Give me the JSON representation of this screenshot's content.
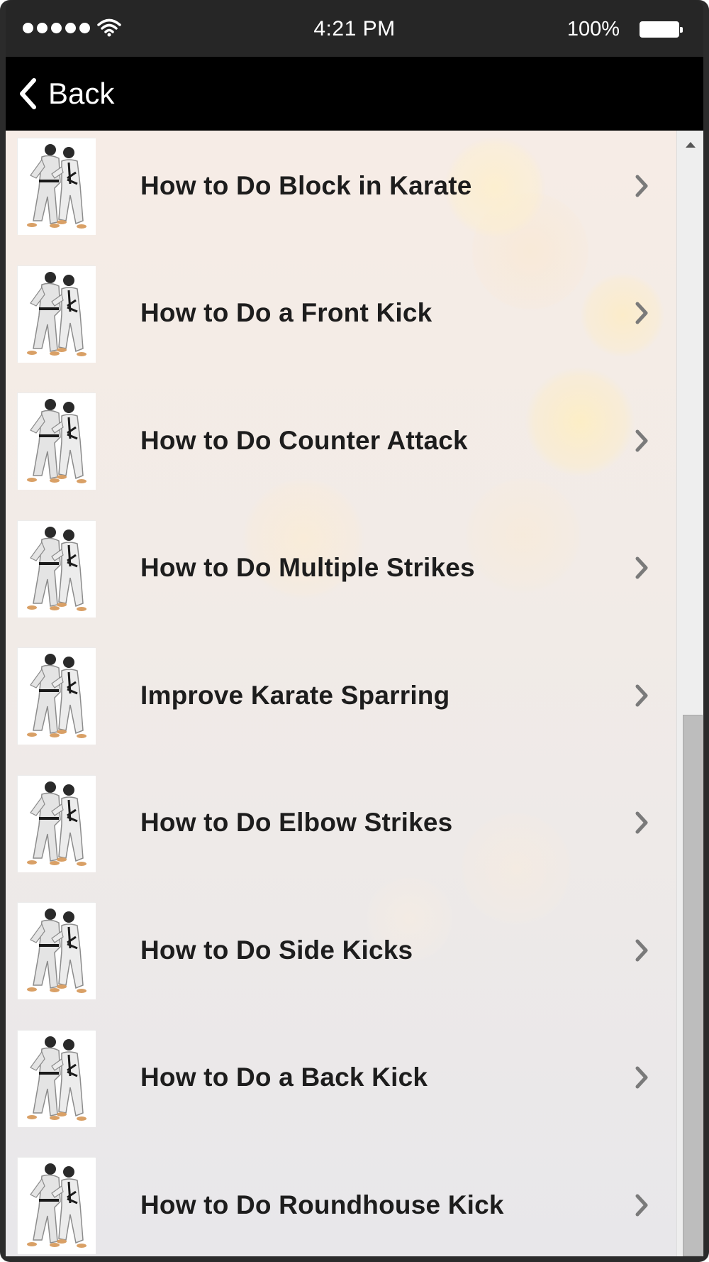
{
  "status_bar": {
    "time": "4:21 PM",
    "battery_percent": "100%",
    "signal_bars": 5,
    "battery_level": 1.0,
    "icons": [
      "signal-dots-icon",
      "wifi-icon",
      "battery-icon"
    ]
  },
  "nav": {
    "back_label": "Back",
    "back_icon": "chevron-left-icon"
  },
  "list": {
    "items": [
      {
        "label": "How to Do Block in Karate",
        "thumbnail": "karate-thumbnail-icon"
      },
      {
        "label": "How to Do a Front Kick",
        "thumbnail": "karate-thumbnail-icon"
      },
      {
        "label": "How to Do Counter Attack",
        "thumbnail": "karate-thumbnail-icon"
      },
      {
        "label": "How to Do Multiple Strikes",
        "thumbnail": "karate-thumbnail-icon"
      },
      {
        "label": "Improve Karate Sparring",
        "thumbnail": "karate-thumbnail-icon"
      },
      {
        "label": "How to Do Elbow Strikes",
        "thumbnail": "karate-thumbnail-icon"
      },
      {
        "label": "How to Do Side Kicks",
        "thumbnail": "karate-thumbnail-icon"
      },
      {
        "label": "How to Do a Back Kick",
        "thumbnail": "karate-thumbnail-icon"
      },
      {
        "label": "How to Do Roundhouse Kick",
        "thumbnail": "karate-thumbnail-icon"
      }
    ],
    "row_icon": "chevron-right-icon"
  },
  "scrollbar": {
    "position_fraction": 1.0
  },
  "colors": {
    "nav_background": "#000000",
    "status_background": "#262626",
    "label_text": "#1d1d1d",
    "chevron": "#7a7a7a",
    "scroll_thumb": "#bdbdbd"
  }
}
